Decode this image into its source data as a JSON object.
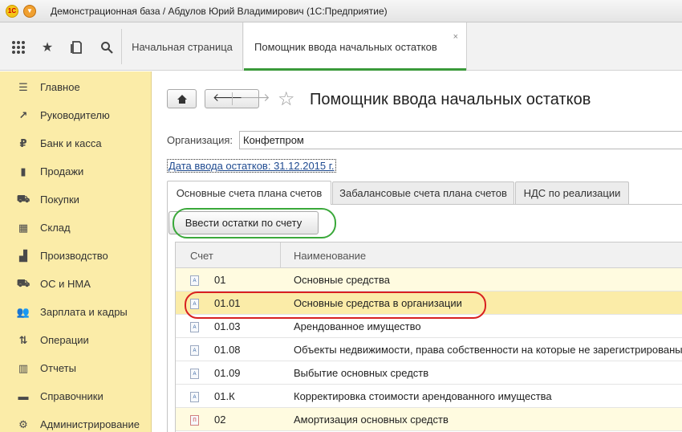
{
  "window": {
    "title": "Демонстрационная база / Абдулов Юрий Владимирович (1С:Предприятие)",
    "logo_text": "1С"
  },
  "toolbar": {
    "icons": [
      "apps-grid-icon",
      "star-icon",
      "history-icon",
      "search-icon"
    ]
  },
  "tabs": [
    {
      "label": "Начальная страница",
      "active": false
    },
    {
      "label": "Помощник ввода начальных остатков",
      "active": true,
      "close": "×"
    }
  ],
  "sidebar": {
    "items": [
      {
        "label": "Главное",
        "icon": "menu-lines-icon",
        "glyph": "☰"
      },
      {
        "label": "Руководителю",
        "icon": "trend-icon",
        "glyph": "↗"
      },
      {
        "label": "Банк и касса",
        "icon": "ruble-coin-icon",
        "glyph": "₽"
      },
      {
        "label": "Продажи",
        "icon": "shopping-bag-icon",
        "glyph": "▮"
      },
      {
        "label": "Покупки",
        "icon": "cart-icon",
        "glyph": "⛟"
      },
      {
        "label": "Склад",
        "icon": "warehouse-icon",
        "glyph": "▦"
      },
      {
        "label": "Производство",
        "icon": "factory-icon",
        "glyph": "▟"
      },
      {
        "label": "ОС и НМА",
        "icon": "truck-icon",
        "glyph": "⛟"
      },
      {
        "label": "Зарплата и кадры",
        "icon": "people-icon",
        "glyph": "👥"
      },
      {
        "label": "Операции",
        "icon": "debit-credit-icon",
        "glyph": "⇅"
      },
      {
        "label": "Отчеты",
        "icon": "bar-chart-icon",
        "glyph": "▥"
      },
      {
        "label": "Справочники",
        "icon": "book-icon",
        "glyph": "▬"
      },
      {
        "label": "Администрирование",
        "icon": "gear-icon",
        "glyph": "⚙"
      }
    ]
  },
  "page": {
    "title": "Помощник ввода начальных остатков",
    "org_label": "Организация:",
    "org_value": "Конфетпром",
    "date_link": "Дата ввода остатков: 31.12.2015 г."
  },
  "form_tabs": [
    {
      "label": "Основные счета плана счетов",
      "active": true
    },
    {
      "label": "Забалансовые счета плана счетов",
      "active": false
    },
    {
      "label": "НДС по реализации",
      "active": false
    }
  ],
  "action": {
    "enter_balances": "Ввести остатки по счету"
  },
  "table": {
    "columns": [
      "Счет",
      "Наименование"
    ],
    "rows": [
      {
        "code": "01",
        "name": "Основные средства",
        "icon_label": "А",
        "style": "yellow"
      },
      {
        "code": "01.01",
        "name": "Основные средства в организации",
        "icon_label": "А",
        "style": "selected"
      },
      {
        "code": "01.03",
        "name": "Арендованное имущество",
        "icon_label": "А",
        "style": "plain"
      },
      {
        "code": "01.08",
        "name": "Объекты недвижимости, права собственности на которые не зарегистрированы",
        "icon_label": "А",
        "style": "plain"
      },
      {
        "code": "01.09",
        "name": "Выбытие основных средств",
        "icon_label": "А",
        "style": "plain"
      },
      {
        "code": "01.К",
        "name": "Корректировка стоимости арендованного имущества",
        "icon_label": "А",
        "style": "plain"
      },
      {
        "code": "02",
        "name": "Амортизация основных средств",
        "icon_label": "П",
        "style": "yellow"
      }
    ]
  }
}
